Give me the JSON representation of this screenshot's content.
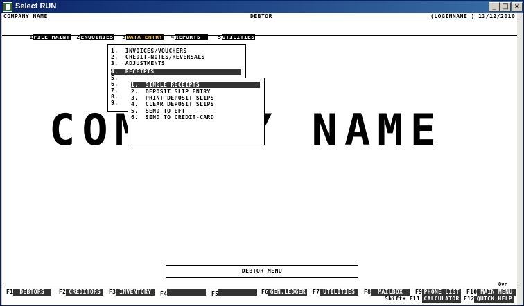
{
  "window": {
    "title": "Select RUN",
    "minimize": "_",
    "maximize": "□",
    "close": "×"
  },
  "header": {
    "company": "COMPANY NAME",
    "module": "DEBTOR",
    "user_date": "(LOGINNAME ) 13/12/2010"
  },
  "menubar": [
    {
      "num": "1",
      "label": "FILE MAINT"
    },
    {
      "num": "2",
      "label": "ENQUIRIES"
    },
    {
      "num": "3",
      "label": "DATA ENTRY"
    },
    {
      "num": "4",
      "label": "REPORTS  "
    },
    {
      "num": "5",
      "label": "UTILITIES"
    }
  ],
  "background_text": "COMPANY NAME",
  "data_entry_menu": [
    "1.  INVOICES/VOUCHERS",
    "2.  CREDIT-NOTES/REVERSALS",
    "3.  ADJUSTMENTS",
    "4.  RECEIPTS",
    "5.",
    "6.",
    "7.",
    "8.",
    "9."
  ],
  "receipts_menu": [
    "1.  SINGLE RECEIPTS",
    "2.  DEPOSIT SLIP ENTRY",
    "3.  PRINT DEPOSIT SLIPS",
    "4.  CLEAR DEPOSIT SLIPS",
    "5.  SEND TO EFT",
    "6.  SEND TO CREDIT-CARD"
  ],
  "footer_title": "DEBTOR MENU",
  "ovr": "Ovr",
  "shift_label": "Shift+ F11",
  "fkeys": [
    {
      "key": "F1",
      "label": "DEBTORS"
    },
    {
      "key": "F2",
      "label": "CREDITORS"
    },
    {
      "key": "F3",
      "label": "INVENTORY"
    },
    {
      "key": "F4",
      "label": ""
    },
    {
      "key": "F5",
      "label": ""
    },
    {
      "key": "F6",
      "label": "GEN.LEDGER"
    },
    {
      "key": "F7",
      "label": "UTILITIES"
    },
    {
      "key": "F8",
      "label": "MAILBOX"
    },
    {
      "key": "F9",
      "label": "PHONE LIST"
    },
    {
      "key": "F10",
      "label": "MAIN MENU"
    }
  ],
  "fkeys_row2": [
    {
      "key": "F11",
      "label": "CALCULATOR"
    },
    {
      "key": "F12",
      "label": "QUICK HELP"
    }
  ]
}
